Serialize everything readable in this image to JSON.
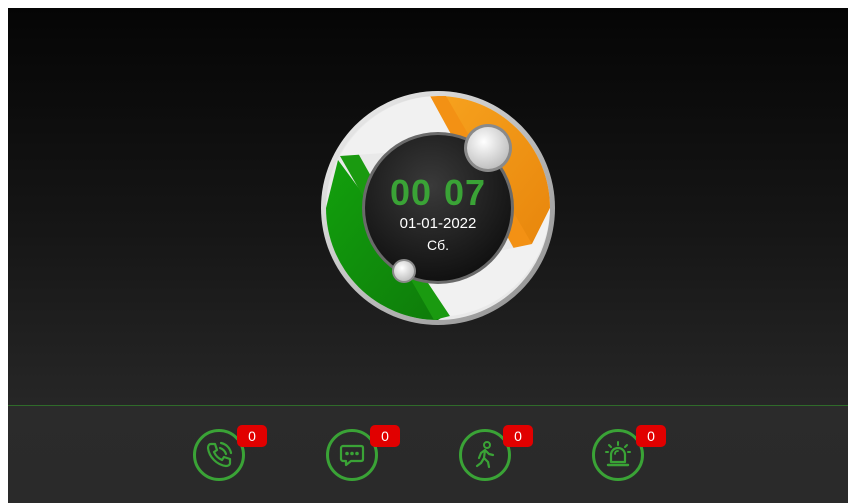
{
  "clock": {
    "hours": "00",
    "minutes": "07",
    "date": "01-01-2022",
    "day": "Сб."
  },
  "colors": {
    "accent_green": "#3aa336",
    "ring_orange": "#f39114",
    "ring_green": "#1a9a10",
    "badge_red": "#e10000"
  },
  "nav": [
    {
      "icon": "phone-call-icon",
      "badge": "0"
    },
    {
      "icon": "message-icon",
      "badge": "0"
    },
    {
      "icon": "motion-walker-icon",
      "badge": "0"
    },
    {
      "icon": "alarm-siren-icon",
      "badge": "0"
    }
  ]
}
